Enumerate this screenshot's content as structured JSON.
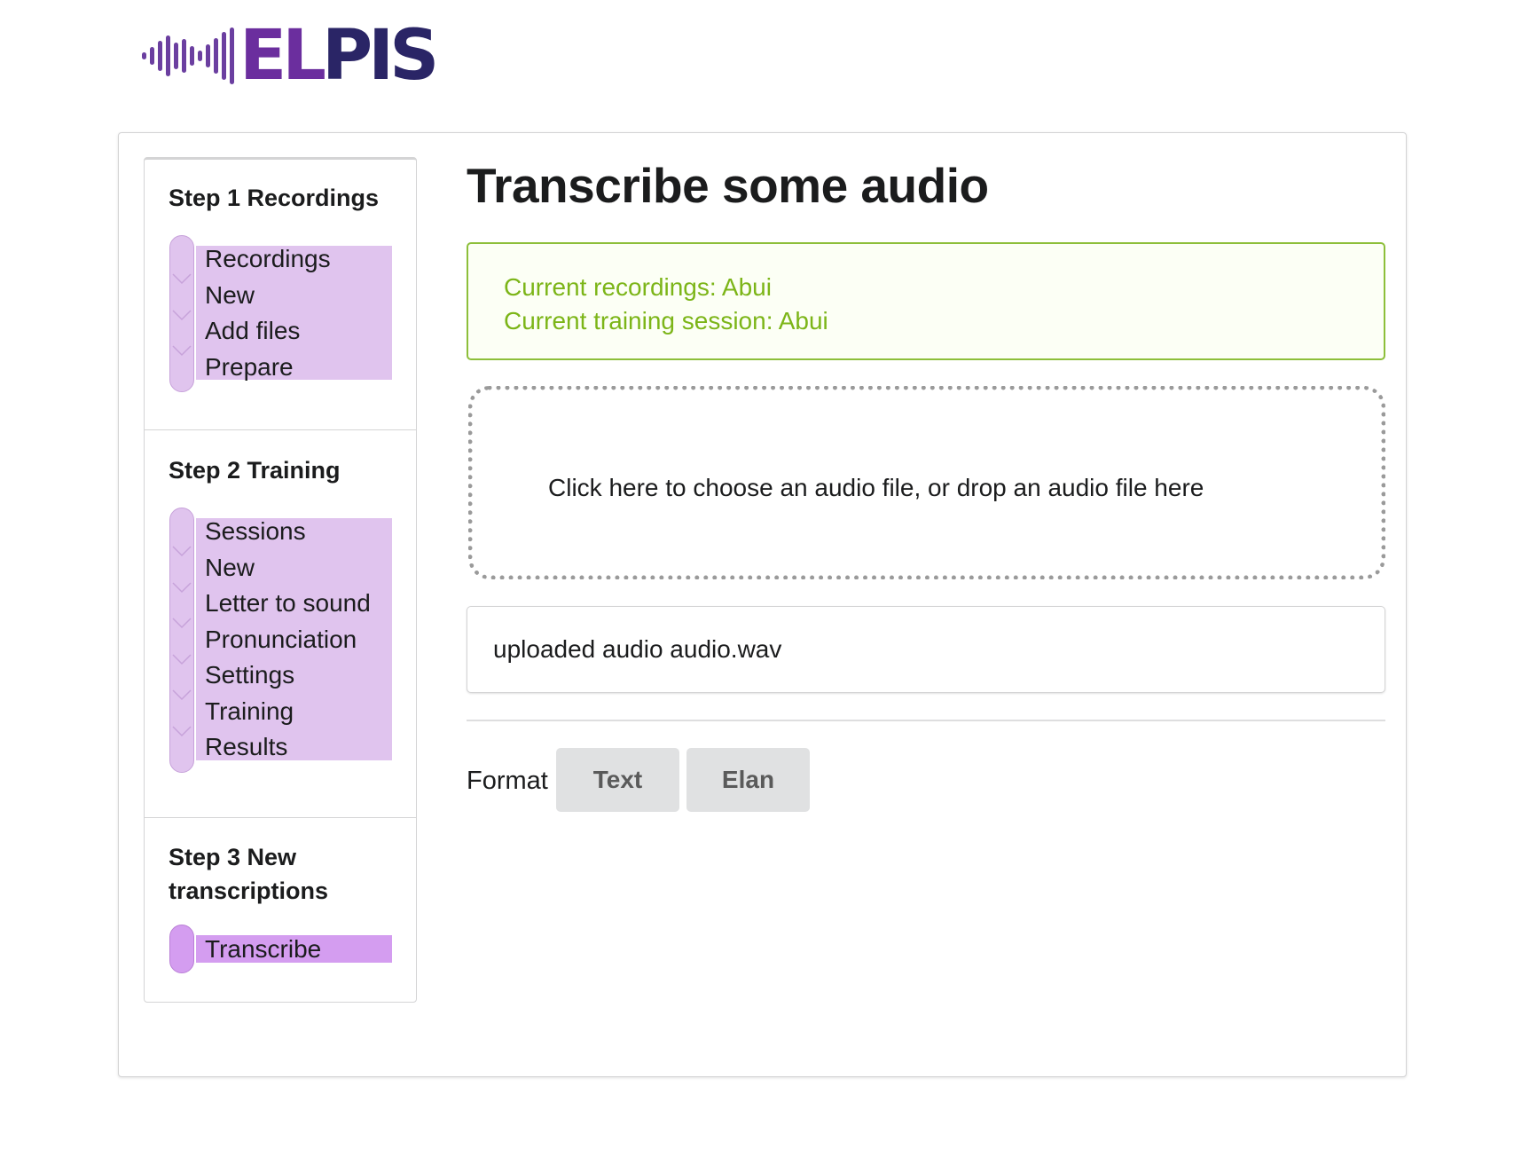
{
  "brand": {
    "logo_text_part1": "EL",
    "logo_text_part2": "PIS",
    "logo_icon": "audio-wave-icon",
    "colors": {
      "purple": "#6b2e9e",
      "navy": "#2a2566"
    }
  },
  "sidebar": {
    "steps": [
      {
        "title": "Step 1 Recordings",
        "items": [
          "Recordings",
          "New",
          "Add files",
          "Prepare"
        ]
      },
      {
        "title": "Step 2 Training",
        "items": [
          "Sessions",
          "New",
          "Letter to sound",
          "Pronunciation",
          "Settings",
          "Training",
          "Results"
        ]
      },
      {
        "title": "Step 3 New transcriptions",
        "items": [
          "Transcribe"
        ],
        "active_item": "Transcribe"
      }
    ],
    "colors": {
      "substep": "#e0c4ee",
      "active": "#d49df0"
    }
  },
  "main": {
    "title": "Transcribe some audio",
    "info": {
      "recordings": "Current recordings: Abui",
      "session": "Current training session: Abui",
      "color": "#7cb518"
    },
    "dropzone_text": "Click here to choose an audio file, or drop an audio file here",
    "uploaded_text": "uploaded audio audio.wav",
    "format": {
      "label": "Format",
      "options": [
        "Text",
        "Elan"
      ]
    }
  }
}
